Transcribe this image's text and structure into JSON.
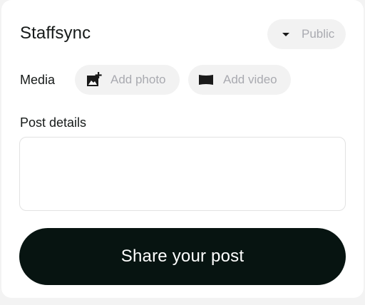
{
  "header": {
    "brand": "Staffsync",
    "visibility": {
      "label": "Public",
      "icon": "caret-down-icon"
    }
  },
  "media": {
    "label": "Media",
    "add_photo": {
      "label": "Add photo",
      "icon": "add-photo-icon"
    },
    "add_video": {
      "label": "Add video",
      "icon": "video-icon"
    }
  },
  "details": {
    "label": "Post details",
    "value": ""
  },
  "submit": {
    "label": "Share your post"
  },
  "colors": {
    "primary_button": "#071411",
    "chip_background": "#f2f2f2",
    "placeholder_text": "#a9aab0",
    "text": "#161a19"
  }
}
